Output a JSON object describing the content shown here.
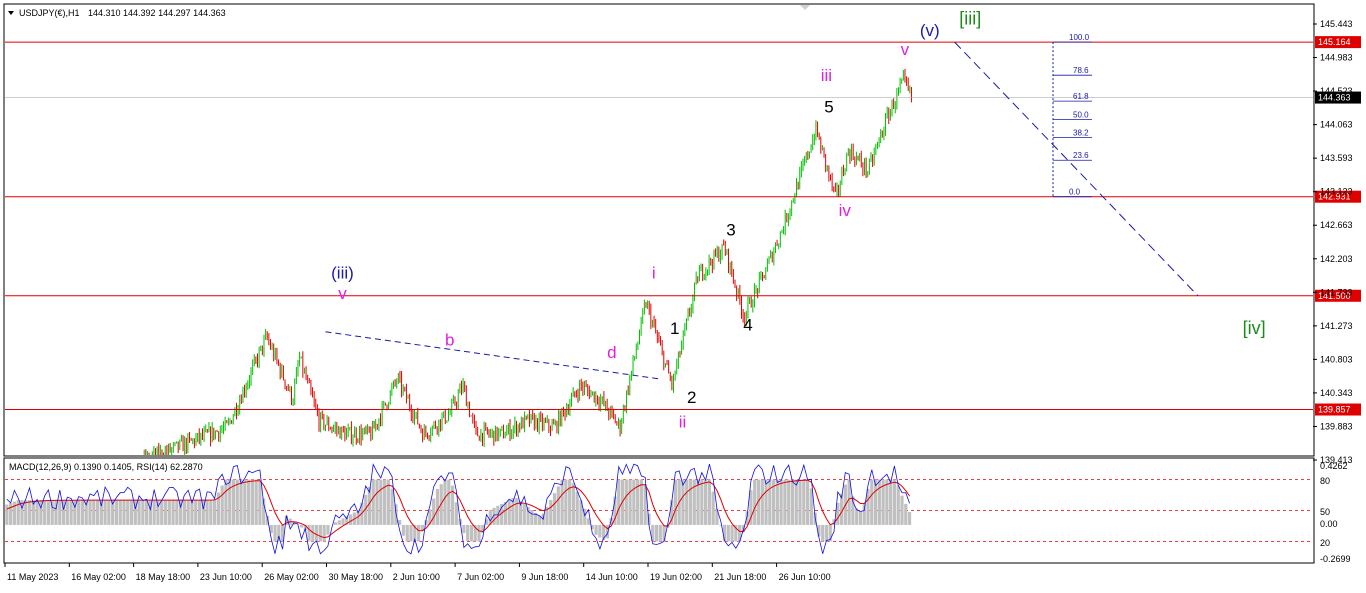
{
  "header": {
    "symbol": "USDJPY(€),H1",
    "ohlc": "144.310 144.392 144.297 144.363",
    "indicator_caption": "MACD(12,26,9) 0.1390 0.1405, RSI(14) 62.2870"
  },
  "colors": {
    "bull": "#00c000",
    "bear": "#e00000",
    "level_line": "#e00000",
    "wave_blue": "#1a1aa8",
    "wave_magenta": "#e020e0",
    "wave_green": "#1a8a1a",
    "fib": "#1a1aa8",
    "macd_hist": "#c0c0c0",
    "macd_signal": "#e00000",
    "rsi": "#1010e0"
  },
  "chart_data": [
    {
      "type": "candlestick",
      "title": "USDJPY(€),H1",
      "ylim": [
        139.2,
        145.7
      ],
      "y_ticks": [
        "145.443",
        "144.983",
        "144.523",
        "144.063",
        "143.593",
        "143.123",
        "142.663",
        "142.203",
        "141.733",
        "141.273",
        "140.803",
        "140.343",
        "139.883",
        "139.413"
      ],
      "x_ticks": [
        "11 May 2023",
        "16 May 02:00",
        "18 May 18:00",
        "23 Jun 10:00",
        "26 May 02:00",
        "30 May 18:00",
        "2 Jun 10:00",
        "7 Jun 02:00",
        "9 Jun 18:00",
        "14 Jun 10:00",
        "19 Jun 02:00",
        "21 Jun 18:00",
        "26 Jun 10:00"
      ],
      "current_price": "144.363",
      "price_path": [
        [
          0,
          138.3
        ],
        [
          0.17,
          139.6
        ],
        [
          0.2,
          140.9
        ],
        [
          0.22,
          140.0
        ],
        [
          0.225,
          140.6
        ],
        [
          0.24,
          139.7
        ],
        [
          0.26,
          139.5
        ],
        [
          0.28,
          139.5
        ],
        [
          0.3,
          140.3
        ],
        [
          0.32,
          139.5
        ],
        [
          0.34,
          139.8
        ],
        [
          0.35,
          140.2
        ],
        [
          0.36,
          139.5
        ],
        [
          0.38,
          139.5
        ],
        [
          0.4,
          139.7
        ],
        [
          0.42,
          139.6
        ],
        [
          0.44,
          140.2
        ],
        [
          0.455,
          140.0
        ],
        [
          0.47,
          139.6
        ],
        [
          0.49,
          141.4
        ],
        [
          0.51,
          140.2
        ],
        [
          0.53,
          141.8
        ],
        [
          0.55,
          142.2
        ],
        [
          0.565,
          141.2
        ],
        [
          0.58,
          141.8
        ],
        [
          0.595,
          142.5
        ],
        [
          0.62,
          143.9
        ],
        [
          0.635,
          142.9
        ],
        [
          0.645,
          143.6
        ],
        [
          0.66,
          143.3
        ],
        [
          0.675,
          144.1
        ],
        [
          0.687,
          144.6
        ],
        [
          0.693,
          144.35
        ]
      ],
      "levels": [
        {
          "value": 145.164,
          "label": "145.164"
        },
        {
          "value": 142.931,
          "label": "142.931"
        },
        {
          "value": 141.5,
          "label": "141.500"
        },
        {
          "value": 139.857,
          "label": "139.857"
        }
      ],
      "fibonacci": {
        "from": 142.931,
        "to": 145.164,
        "levels": [
          {
            "ratio": 1.0,
            "label": "100.0"
          },
          {
            "ratio": 0.786,
            "label": "78.6"
          },
          {
            "ratio": 0.618,
            "label": "61.8"
          },
          {
            "ratio": 0.5,
            "label": "50.0"
          },
          {
            "ratio": 0.382,
            "label": "38.2"
          },
          {
            "ratio": 0.236,
            "label": "23.6"
          },
          {
            "ratio": 0.0,
            "label": "0.0"
          }
        ]
      },
      "projection_line": {
        "from": [
          0.726,
          145.164
        ],
        "to": [
          0.912,
          141.5
        ]
      },
      "trend_line": {
        "from": [
          0.245,
          140.98
        ],
        "to": [
          0.5,
          140.3
        ]
      },
      "wave_labels": [
        {
          "text": "(iii)",
          "t": 0.258,
          "p": 141.75,
          "color": "blue"
        },
        {
          "text": "v",
          "t": 0.258,
          "p": 141.45,
          "color": "magenta"
        },
        {
          "text": "b",
          "t": 0.34,
          "p": 140.78,
          "color": "magenta"
        },
        {
          "text": "d",
          "t": 0.464,
          "p": 140.6,
          "color": "magenta"
        },
        {
          "text": "i",
          "t": 0.496,
          "p": 141.75,
          "color": "magenta"
        },
        {
          "text": "1",
          "t": 0.512,
          "p": 140.95,
          "color": "black"
        },
        {
          "text": "2",
          "t": 0.525,
          "p": 139.95,
          "color": "black"
        },
        {
          "text": "ii",
          "t": 0.518,
          "p": 139.6,
          "color": "magenta"
        },
        {
          "text": "3",
          "t": 0.555,
          "p": 142.37,
          "color": "black"
        },
        {
          "text": "4",
          "t": 0.568,
          "p": 141.0,
          "color": "black"
        },
        {
          "text": "5",
          "t": 0.63,
          "p": 144.15,
          "color": "black"
        },
        {
          "text": "iii",
          "t": 0.628,
          "p": 144.6,
          "color": "magenta"
        },
        {
          "text": "iv",
          "t": 0.642,
          "p": 142.65,
          "color": "magenta"
        },
        {
          "text": "v",
          "t": 0.688,
          "p": 144.98,
          "color": "magenta"
        },
        {
          "text": "(v)",
          "t": 0.707,
          "p": 145.25,
          "color": "blue"
        },
        {
          "text": "[iii]",
          "t": 0.738,
          "p": 145.42,
          "color": "green"
        },
        {
          "text": "[iv]",
          "t": 0.955,
          "p": 140.95,
          "color": "green"
        }
      ]
    },
    {
      "type": "line",
      "title": "MACD(12,26,9) 0.1390 0.1405, RSI(14) 62.2870",
      "y_ticks_right": [
        "0.4262",
        "80",
        "50",
        "0.00",
        "20",
        "-0.2699"
      ],
      "ylim": [
        0,
        100
      ],
      "reference_lines": [
        80,
        50,
        20
      ],
      "series": [
        {
          "name": "MACD(12,26,9)"
        },
        {
          "name": "RSI(14)"
        }
      ]
    }
  ]
}
